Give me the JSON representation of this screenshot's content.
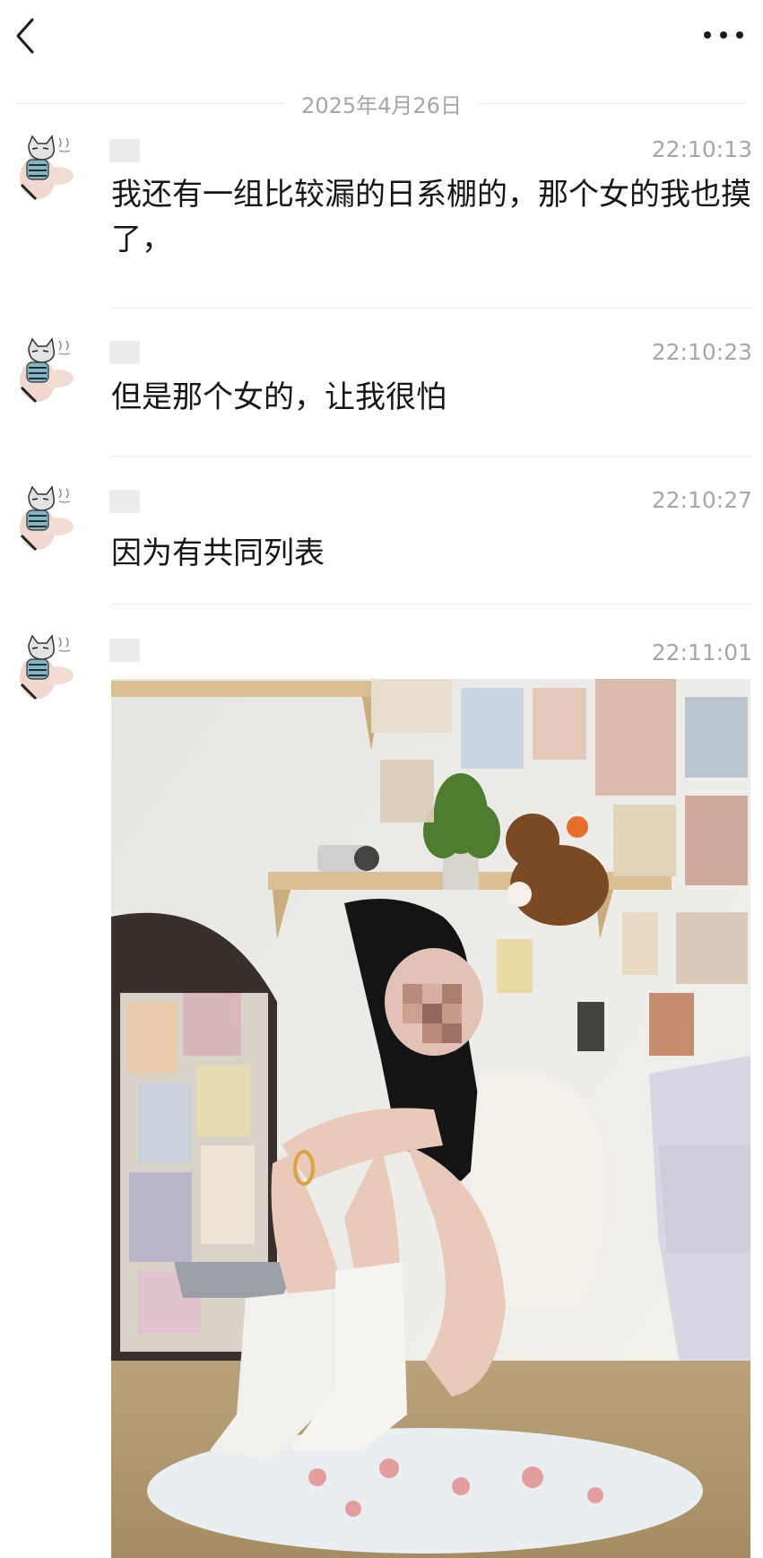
{
  "header": {
    "back_icon": "chevron-left-icon",
    "more_icon": "more-dots-icon"
  },
  "date_divider": "2025年4月26日",
  "messages": [
    {
      "time": "22:10:13",
      "text": "我还有一组比较漏的日系棚的，那个女的我也摸了，",
      "avatar_icon": "cat-avatar"
    },
    {
      "time": "22:10:23",
      "text": "但是那个女的，让我很怕",
      "avatar_icon": "cat-avatar"
    },
    {
      "time": "22:10:27",
      "text": "因为有共同列表",
      "avatar_icon": "cat-avatar"
    },
    {
      "time": "22:11:01",
      "type": "image",
      "avatar_icon": "cat-avatar"
    }
  ],
  "colors": {
    "background": "#ffffff",
    "meta_text": "#a6a6a6",
    "body_text": "#161616",
    "divider": "#e8e8e8"
  }
}
